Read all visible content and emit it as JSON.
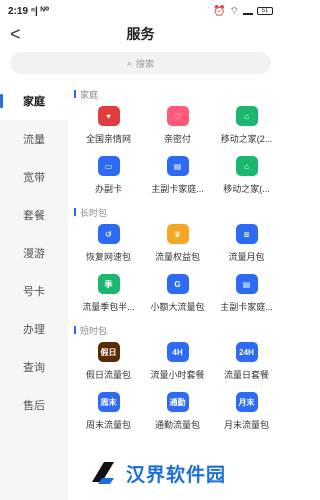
{
  "statusbar": {
    "time": "2:19",
    "network": "ⁿ| ᴺ⁰",
    "battery": "51"
  },
  "header": {
    "title": "服务",
    "back_icon": "chevron-left-icon"
  },
  "search": {
    "placeholder": "搜索"
  },
  "sidebar": {
    "items": [
      {
        "label": "家庭",
        "active": true
      },
      {
        "label": "流量",
        "active": false
      },
      {
        "label": "宽带",
        "active": false
      },
      {
        "label": "套餐",
        "active": false
      },
      {
        "label": "漫游",
        "active": false
      },
      {
        "label": "号卡",
        "active": false
      },
      {
        "label": "办理",
        "active": false
      },
      {
        "label": "查询",
        "active": false
      },
      {
        "label": "售后",
        "active": false
      }
    ]
  },
  "sections": [
    {
      "title": "家庭",
      "items": [
        {
          "label": "全国亲情网",
          "icon": "heart-icon",
          "color": "#e13d3d",
          "glyph": "♥"
        },
        {
          "label": "亲密付",
          "icon": "pay-icon",
          "color": "#ff5a7a",
          "glyph": "♡"
        },
        {
          "label": "移动之家(2...",
          "icon": "home-icon",
          "color": "#1bb76e",
          "glyph": "⌂"
        },
        {
          "label": "办副卡",
          "icon": "card-icon",
          "color": "#2d6bf5",
          "glyph": "▭"
        },
        {
          "label": "主副卡家庭...",
          "icon": "family-card-icon",
          "color": "#2d6bf5",
          "glyph": "▤"
        },
        {
          "label": "移动之家(...",
          "icon": "home-icon",
          "color": "#1bb76e",
          "glyph": "⌂"
        }
      ]
    },
    {
      "title": "长时包",
      "items": [
        {
          "label": "恢复网速包",
          "icon": "restore-icon",
          "color": "#2d6bf5",
          "glyph": "↺"
        },
        {
          "label": "流量权益包",
          "icon": "crown-icon",
          "color": "#f5a623",
          "glyph": "♛"
        },
        {
          "label": "流量月包",
          "icon": "data-icon",
          "color": "#2d6bf5",
          "glyph": "≋"
        },
        {
          "label": "流量季包半...",
          "icon": "quarter-icon",
          "color": "#1bb76e",
          "glyph": "季"
        },
        {
          "label": "小额大流量包",
          "icon": "g-icon",
          "color": "#2d6bf5",
          "glyph": "G"
        },
        {
          "label": "主副卡家庭...",
          "icon": "family-card-icon",
          "color": "#2d6bf5",
          "glyph": "▤"
        }
      ]
    },
    {
      "title": "短时包",
      "items": [
        {
          "label": "假日流量包",
          "icon": "holiday-icon",
          "color": "#5a2a00",
          "glyph": "假日"
        },
        {
          "label": "流量小时套餐",
          "icon": "4h-icon",
          "color": "#2d6bf5",
          "glyph": "4H"
        },
        {
          "label": "流量日套餐",
          "icon": "24h-icon",
          "color": "#2d6bf5",
          "glyph": "24H"
        },
        {
          "label": "周末流量包",
          "icon": "weekend-icon",
          "color": "#2d6bf5",
          "glyph": "周末"
        },
        {
          "label": "通勤流量包",
          "icon": "commute-icon",
          "color": "#2d6bf5",
          "glyph": "通勤"
        },
        {
          "label": "月末流量包",
          "icon": "monthend-icon",
          "color": "#2d6bf5",
          "glyph": "月末"
        }
      ]
    }
  ],
  "watermark": {
    "text": "汉界软件园"
  }
}
